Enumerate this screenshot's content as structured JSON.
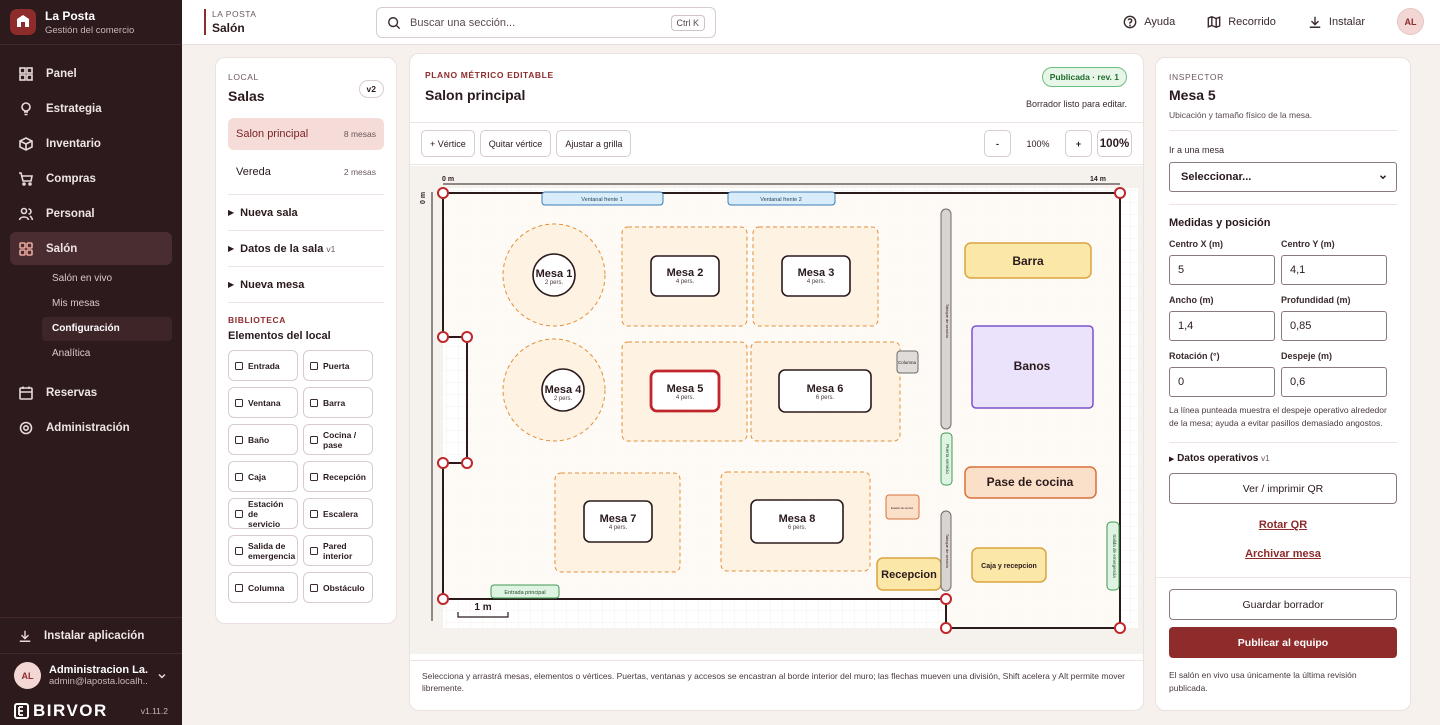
{
  "brand": {
    "name": "La Posta",
    "subtitle": "Gestión del comercio"
  },
  "nav": {
    "items": [
      {
        "label": "Panel",
        "icon": "grid-icon"
      },
      {
        "label": "Estrategia",
        "icon": "lightbulb-icon"
      },
      {
        "label": "Inventario",
        "icon": "box-icon"
      },
      {
        "label": "Compras",
        "icon": "cart-icon"
      },
      {
        "label": "Personal",
        "icon": "users-icon"
      },
      {
        "label": "Salón",
        "icon": "layout-icon"
      },
      {
        "label": "Reservas",
        "icon": "calendar-icon"
      },
      {
        "label": "Administración",
        "icon": "gear-icon"
      }
    ],
    "subitems": [
      "Salón en vivo",
      "Mis mesas",
      "Configuración",
      "Analítica"
    ],
    "install": "Instalar aplicación",
    "user": {
      "initials": "AL",
      "name": "Administracion La...",
      "email": "admin@laposta.localh..."
    },
    "footer_brand": "BIRVOR",
    "version": "v1.11.2"
  },
  "topbar": {
    "crumb_small": "LA POSTA",
    "crumb_title": "Salón",
    "search_placeholder": "Buscar una sección...",
    "search_kbd": "Ctrl K",
    "actions": [
      "Ayuda",
      "Recorrido",
      "Instalar"
    ],
    "avatar": "AL"
  },
  "salas": {
    "section_label": "LOCAL",
    "title": "Salas",
    "version_badge": "v2",
    "rooms": [
      {
        "name": "Salon principal",
        "count": "8 mesas"
      },
      {
        "name": "Vereda",
        "count": "2 mesas"
      }
    ],
    "expanders": [
      {
        "label": "Nueva sala",
        "suffix": ""
      },
      {
        "label": "Datos de la sala",
        "suffix": "v1"
      },
      {
        "label": "Nueva mesa",
        "suffix": ""
      }
    ],
    "library_label": "BIBLIOTECA",
    "library_title": "Elementos del local",
    "library": [
      "Entrada",
      "Puerta",
      "Ventana",
      "Barra",
      "Baño",
      "Cocina / pase",
      "Caja",
      "Recepción",
      "Estación de servicio",
      "Escalera",
      "Salida de emergencia",
      "Pared interior",
      "Columna",
      "Obstáculo"
    ]
  },
  "editor": {
    "label": "PLANO MÉTRICO EDITABLE",
    "title": "Salon principal",
    "status_badge": "Publicada · rev. 1",
    "draft_note": "Borrador listo para editar.",
    "tools": [
      "+ Vértice",
      "Quitar vértice",
      "Ajustar a grilla"
    ],
    "zoom_minus": "-",
    "zoom_value": "100%",
    "zoom_plus": "+",
    "zoom_reset": "100%",
    "footer_note": "Selecciona y arrastrá mesas, elementos o vértices. Puertas, ventanas y accesos se encastran al borde interior del muro; las flechas mueven una división, Shift acelera y Alt permite mover libremente.",
    "ruler": {
      "x_start": "0 m",
      "x_end": "14 m",
      "y_start": "0 m",
      "scale": "1 m"
    },
    "tables": [
      {
        "name": "Mesa 1",
        "cap": "2 pers."
      },
      {
        "name": "Mesa 2",
        "cap": "4 pers."
      },
      {
        "name": "Mesa 3",
        "cap": "4 pers."
      },
      {
        "name": "Mesa 4",
        "cap": "2 pers."
      },
      {
        "name": "Mesa 5",
        "cap": "4 pers."
      },
      {
        "name": "Mesa 6",
        "cap": "6 pers."
      },
      {
        "name": "Mesa 7",
        "cap": "4 pers."
      },
      {
        "name": "Mesa 8",
        "cap": "6 pers."
      }
    ],
    "elements": {
      "window1": "Ventanal frente 1",
      "window2": "Ventanal frente 2",
      "barra": "Barra",
      "banos": "Banos",
      "pase": "Pase de cocina",
      "recepcion": "Recepcion",
      "caja": "Caja y recepcion",
      "entrada": "Entrada principal",
      "columna": "Columna",
      "salida": "Salida de emergencia",
      "puerta": "Puerta servicio",
      "tabique1": "Tabique de servicio",
      "tabique2": "Tabique de servicio",
      "estacion": "Estación de servicio"
    }
  },
  "inspector": {
    "section_label": "INSPECTOR",
    "title": "Mesa 5",
    "subtitle": "Ubicación y tamaño físico de la mesa.",
    "goto_label": "Ir a una mesa",
    "goto_value": "Seleccionar...",
    "measures_title": "Medidas y posición",
    "fields": [
      {
        "label": "Centro X (m)",
        "value": "5"
      },
      {
        "label": "Centro Y (m)",
        "value": "4,1"
      },
      {
        "label": "Ancho (m)",
        "value": "1,4"
      },
      {
        "label": "Profundidad (m)",
        "value": "0,85"
      },
      {
        "label": "Rotación (°)",
        "value": "0"
      },
      {
        "label": "Despeje (m)",
        "value": "0,6"
      }
    ],
    "help": "La línea punteada muestra el despeje operativo alrededor de la mesa; ayuda a evitar pasillos demasiado angostos.",
    "ops_label": "Datos operativos",
    "ops_suffix": "v1",
    "qr_button": "Ver / imprimir QR",
    "rotate_qr": "Rotar QR",
    "archive": "Archivar mesa",
    "save_draft": "Guardar borrador",
    "publish": "Publicar al equipo",
    "publish_note": "El salón en vivo usa únicamente la última revisión publicada."
  },
  "colors": {
    "sidebar_bg": "#2c1a1d",
    "accent": "#8e2b2b",
    "selected_table": "#c0262b",
    "published_green": "#1f6b2d",
    "banos_purple": "#7b52c9",
    "barra_yellow": "#fbe7a8"
  }
}
